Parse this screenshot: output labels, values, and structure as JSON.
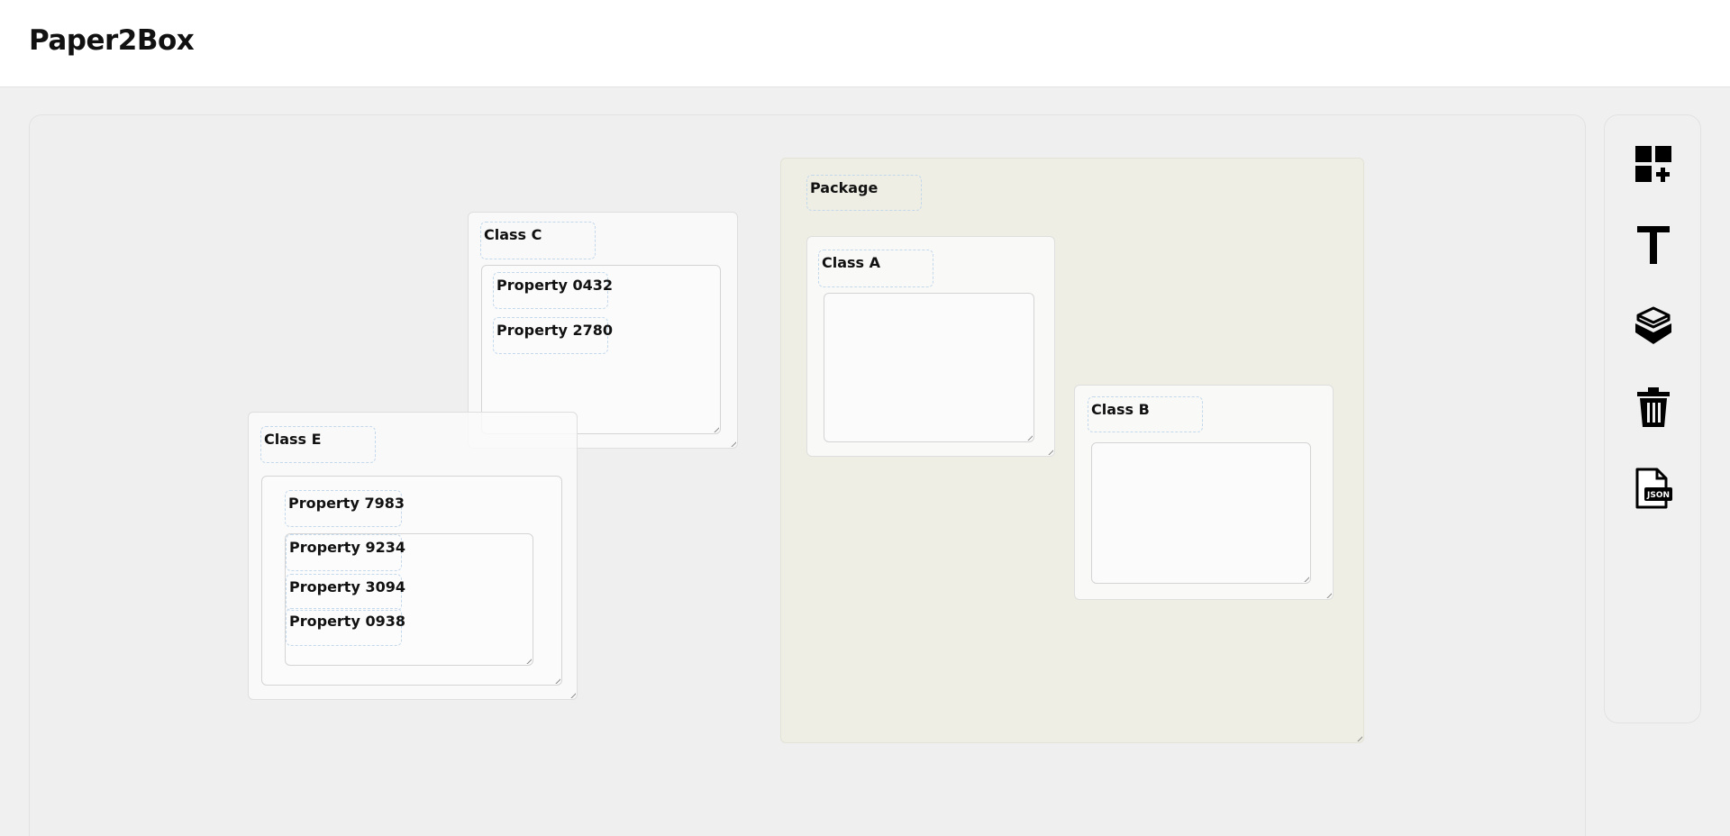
{
  "app": {
    "title": "Paper2Box"
  },
  "toolbar": {
    "tools": [
      {
        "name": "add-class-icon"
      },
      {
        "name": "text-icon"
      },
      {
        "name": "package-icon"
      },
      {
        "name": "trash-icon"
      },
      {
        "name": "json-export-icon",
        "label": "JSON"
      }
    ]
  },
  "diagram": {
    "package": {
      "label": "Package",
      "color": "#efeee4"
    },
    "class_a": {
      "label": "Class A"
    },
    "class_b": {
      "label": "Class B"
    },
    "class_c": {
      "label": "Class C",
      "properties": [
        "Property 0432",
        "Property 2780"
      ]
    },
    "class_e": {
      "label": "Class E",
      "properties": [
        "Property 7983",
        "Property 9234",
        "Property 3094",
        "Property 0938"
      ]
    }
  }
}
